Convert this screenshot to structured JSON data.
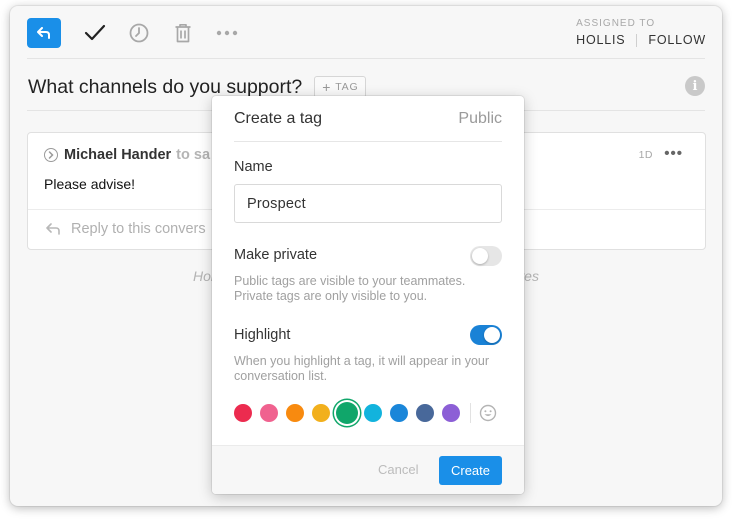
{
  "toolbar": {
    "reply_icon": "reply-arrow-icon",
    "done_icon": "checkmark-icon",
    "snooze_icon": "clock-icon",
    "delete_icon": "trash-icon",
    "more_icon": "ellipsis-icon",
    "assigned_label": "ASSIGNED TO",
    "assignee": "HOLLIS",
    "follow": "FOLLOW"
  },
  "conversation": {
    "title": "What channels do you support?",
    "tag_button": "TAG",
    "info_icon": "i"
  },
  "message": {
    "sender": "Michael Hander",
    "to_prefix": "to sa",
    "time": "1D",
    "more": "•••",
    "body": "Please advise!",
    "reply_placeholder": "Reply to this convers"
  },
  "footnote": {
    "left": "Holl",
    "right": "ves"
  },
  "popover": {
    "title": "Create a tag",
    "visibility": "Public",
    "name_label": "Name",
    "name_value": "Prospect",
    "private_label": "Make private",
    "private_on": false,
    "private_help_1": "Public tags are visible to your teammates.",
    "private_help_2": "Private tags are only visible to you.",
    "highlight_label": "Highlight",
    "highlight_on": true,
    "highlight_help_1": "When you highlight a tag, it will appear in your",
    "highlight_help_2": "conversation list.",
    "colors": [
      "#ec2b4f",
      "#f0628f",
      "#f88a0f",
      "#f2b01d",
      "#10a66a",
      "#12b3dd",
      "#1a86d9",
      "#48689a",
      "#8c5fd6"
    ],
    "selected_color": "#10a66a",
    "emoji_icon": "smiley-icon",
    "cancel": "Cancel",
    "create": "Create"
  },
  "colors": {
    "accent": "#1a8fe8"
  }
}
